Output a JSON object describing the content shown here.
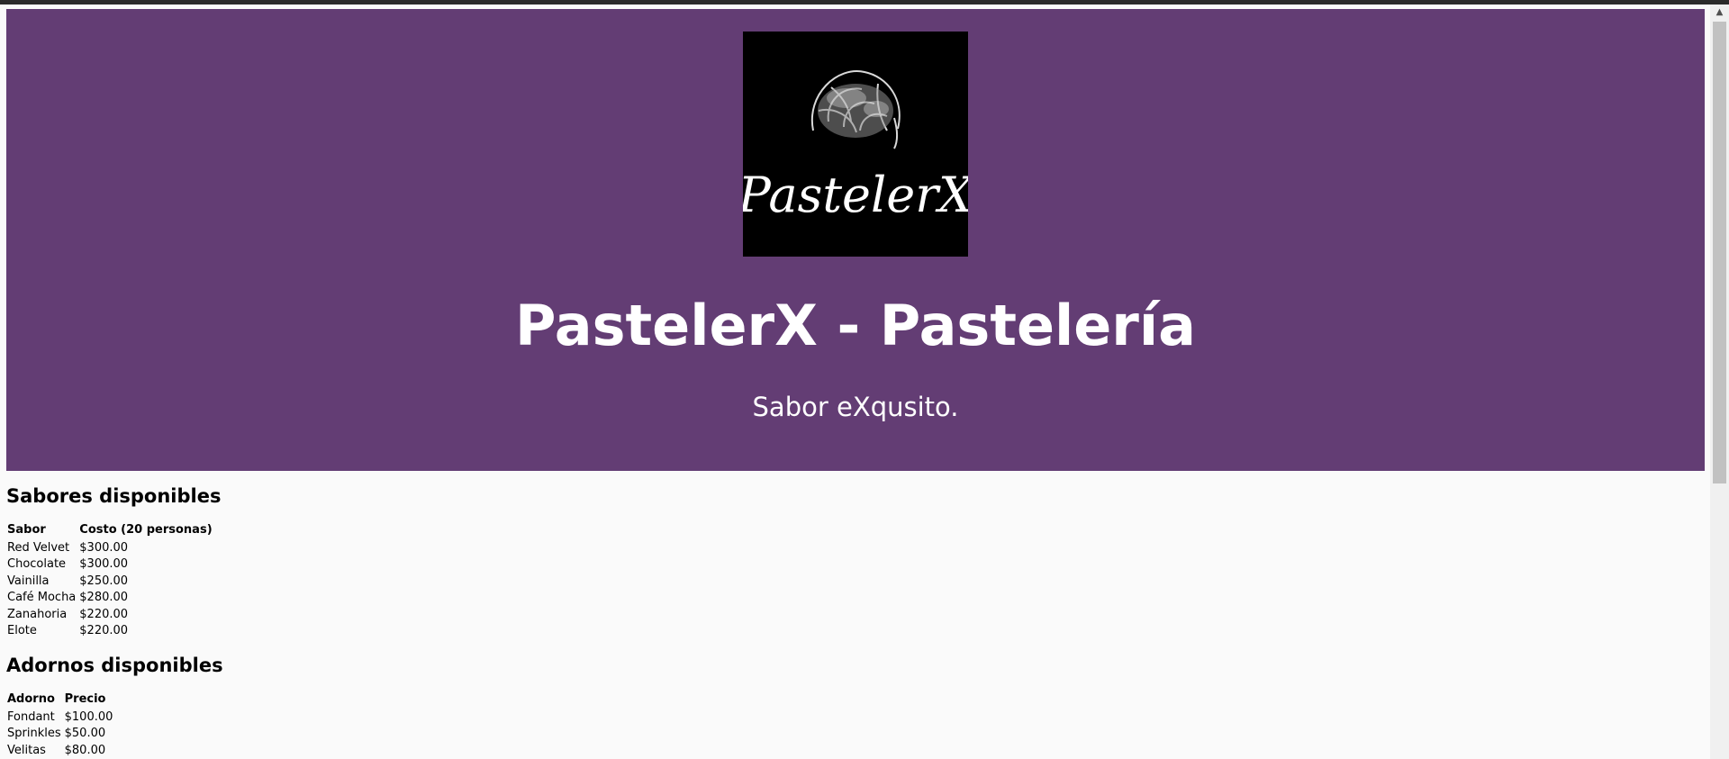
{
  "hero": {
    "logo_text": "PastelerX",
    "title": "PastelerX - Pastelería",
    "subtitle": "Sabor eXqusito."
  },
  "sabores": {
    "heading": "Sabores disponibles",
    "columns": [
      "Sabor",
      "Costo (20 personas)"
    ],
    "rows": [
      [
        "Red Velvet",
        "$300.00"
      ],
      [
        "Chocolate",
        "$300.00"
      ],
      [
        "Vainilla",
        "$250.00"
      ],
      [
        "Café Mocha",
        "$280.00"
      ],
      [
        "Zanahoria",
        "$220.00"
      ],
      [
        "Elote",
        "$220.00"
      ]
    ]
  },
  "adornos": {
    "heading": "Adornos disponibles",
    "columns": [
      "Adorno",
      "Precio"
    ],
    "rows": [
      [
        "Fondant",
        "$100.00"
      ],
      [
        "Sprinkles",
        "$50.00"
      ],
      [
        "Velitas",
        "$80.00"
      ]
    ]
  },
  "colors": {
    "hero_bg": "#633d74",
    "page_bg": "#fafafa"
  },
  "icons": {
    "logo": "croissant-icon",
    "scroll_up": "scroll-up-arrow-icon"
  }
}
